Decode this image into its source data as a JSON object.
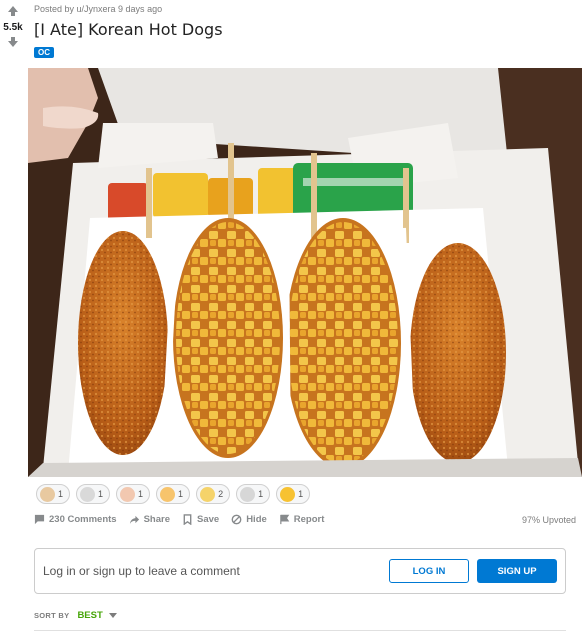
{
  "post": {
    "score": "5.5k",
    "meta": "Posted by u/Jynxera 9 days ago",
    "title": "[I Ate] Korean Hot Dogs",
    "flair": "OC"
  },
  "awards": [
    {
      "count": "1",
      "color": "#e8c9a0",
      "icon": "award-hands-icon"
    },
    {
      "count": "1",
      "color": "#d9d9d9",
      "icon": "award-face-icon"
    },
    {
      "count": "1",
      "color": "#f2c8b0",
      "icon": "award-cat-icon"
    },
    {
      "count": "1",
      "color": "#f7c46c",
      "icon": "award-heart-eyes-icon"
    },
    {
      "count": "2",
      "color": "#f5d36a",
      "icon": "award-laugh-icon"
    },
    {
      "count": "1",
      "color": "#d7d7d7",
      "icon": "award-robot-icon"
    },
    {
      "count": "1",
      "color": "#f7c232",
      "icon": "award-sunglasses-icon"
    }
  ],
  "actions": {
    "comments": "230 Comments",
    "share": "Share",
    "save": "Save",
    "hide": "Hide",
    "report": "Report",
    "upvoted": "97% Upvoted"
  },
  "login": {
    "prompt": "Log in or sign up to leave a comment",
    "login_label": "LOG IN",
    "signup_label": "SIGN UP"
  },
  "sort": {
    "label": "SORT BY",
    "value": "BEST"
  },
  "colors": {
    "accent": "#0079d3",
    "sort_green": "#46a508"
  }
}
